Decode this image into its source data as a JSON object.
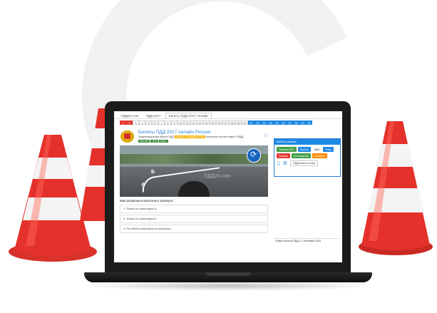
{
  "site": {
    "nav_tabs": [
      "ПДД24.com",
      "ПДД 2017",
      "Билеты ПДД 2017 онлайн"
    ],
    "active_tab": 2,
    "ticket_numbers": [
      "1",
      "2",
      "3",
      "4",
      "5",
      "6",
      "7",
      "8",
      "9",
      "10",
      "11",
      "12",
      "13",
      "14",
      "15",
      "16",
      "17",
      "18",
      "19",
      "20",
      "21",
      "22",
      "23",
      "24",
      "25",
      "26",
      "27",
      "28",
      "29",
      "30"
    ]
  },
  "header": {
    "title": "Билеты ПДД 2017 онлайн России",
    "subtitle_pre": "Экзаменационные билеты ПДД",
    "subtitle_highlight": "новые с 1 сентября 2016",
    "subtitle_post": "полностью соответствуют ГИБДД",
    "badges": [
      "ABM 800",
      "ABM",
      "ABM 1"
    ]
  },
  "photo": {
    "label_a": "А",
    "label_b": "Б",
    "watermark": "ПДД24.com"
  },
  "question": {
    "text": "Вам разрешено выполнить разворот:",
    "answers": [
      "1. Только по траектории А.",
      "2. Только по траектории Б.",
      "3. По любой траектории из указанных."
    ]
  },
  "sidebar": {
    "title": "Выбор режима",
    "buttons": [
      {
        "label": "Экзамен 2017",
        "color": "green"
      },
      {
        "label": "Билеты",
        "color": "blue"
      },
      {
        "label": "АВМ",
        "color": "plain"
      },
      {
        "label": "Темы",
        "color": "blue"
      },
      {
        "label": "Ошибки",
        "color": "red"
      },
      {
        "label": "100 вопросов",
        "color": "green"
      },
      {
        "label": "Марафон",
        "color": "orange"
      }
    ],
    "report_label": "ПДД вызвать на звук",
    "news": "Новые билеты ПДД с 1 сентября 2016"
  },
  "colors": {
    "accent": "#1e88e5",
    "cone_red": "#e5312b",
    "laptop": "#1c1c1c"
  }
}
